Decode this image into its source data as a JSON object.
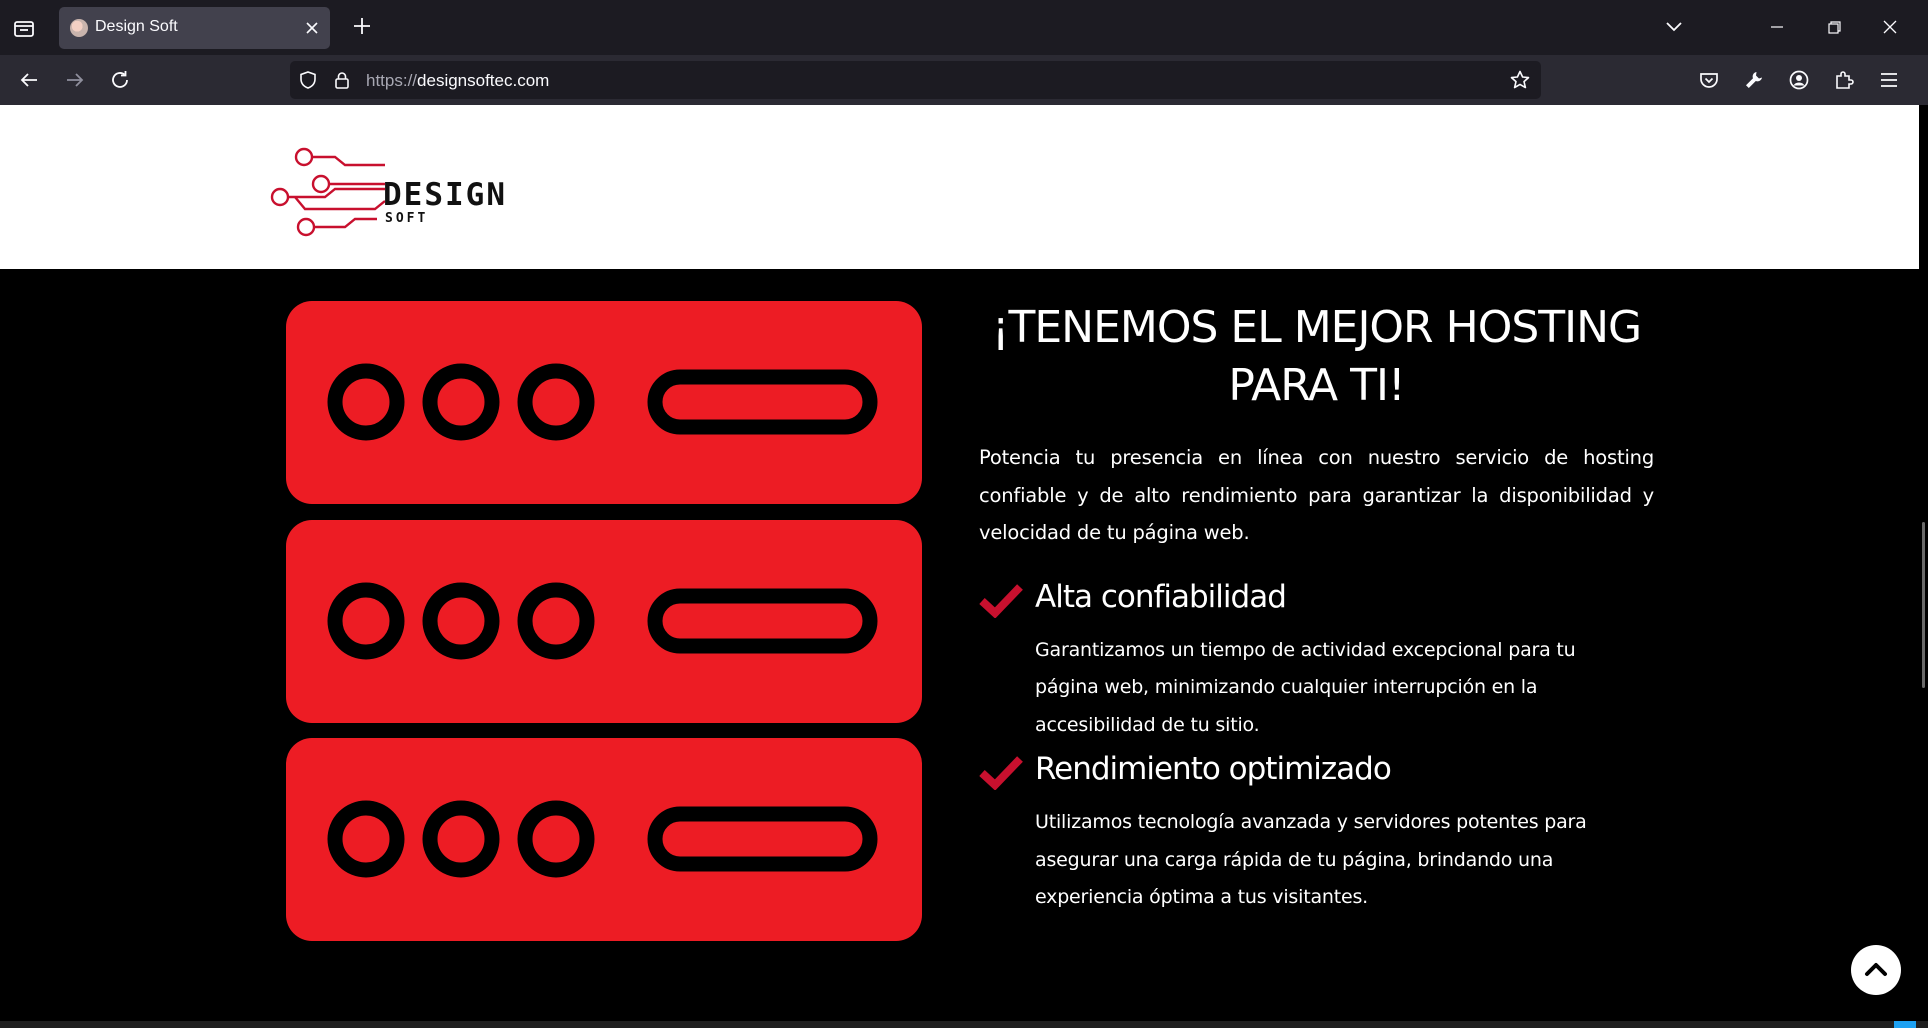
{
  "browser": {
    "tab_title": "Design Soft",
    "url_protocol": "https://",
    "url_host": "designsoftec.com"
  },
  "site": {
    "logo_word": "DESIGN",
    "logo_sub": "SOFT",
    "headline": "¡TENEMOS EL MEJOR HOSTING PARA TI!",
    "intro": "Potencia tu presencia en línea con nuestro servicio de hosting confiable y de alto rendimiento para garantizar la disponibilidad y velocidad de tu página web.",
    "features": [
      {
        "title": "Alta confiabilidad",
        "text": "Garantizamos un tiempo de actividad excepcional para tu página web, minimizando cualquier interrupción en la accesibilidad de tu sitio."
      },
      {
        "title": "Rendimiento optimizado",
        "text": "Utilizamos tecnología avanzada y servidores potentes para asegurar una carga rápida de tu página, brindando una experiencia óptima a tus visitantes."
      }
    ]
  },
  "colors": {
    "accent": "#ed1c24",
    "chrome_dark": "#1c1b22",
    "chrome_toolbar": "#2b2a33"
  },
  "icons": [
    "tab-list-icon",
    "favicon-icon",
    "close-icon",
    "plus-icon",
    "chevron-down-icon",
    "minimize-icon",
    "restore-icon",
    "window-close-icon",
    "back-arrow-icon",
    "forward-arrow-icon",
    "reload-icon",
    "shield-icon",
    "lock-icon",
    "star-icon",
    "pocket-icon",
    "wrench-icon",
    "account-icon",
    "extensions-icon",
    "menu-icon",
    "server-rack-icon",
    "checkmark-icon",
    "arrow-up-icon"
  ]
}
